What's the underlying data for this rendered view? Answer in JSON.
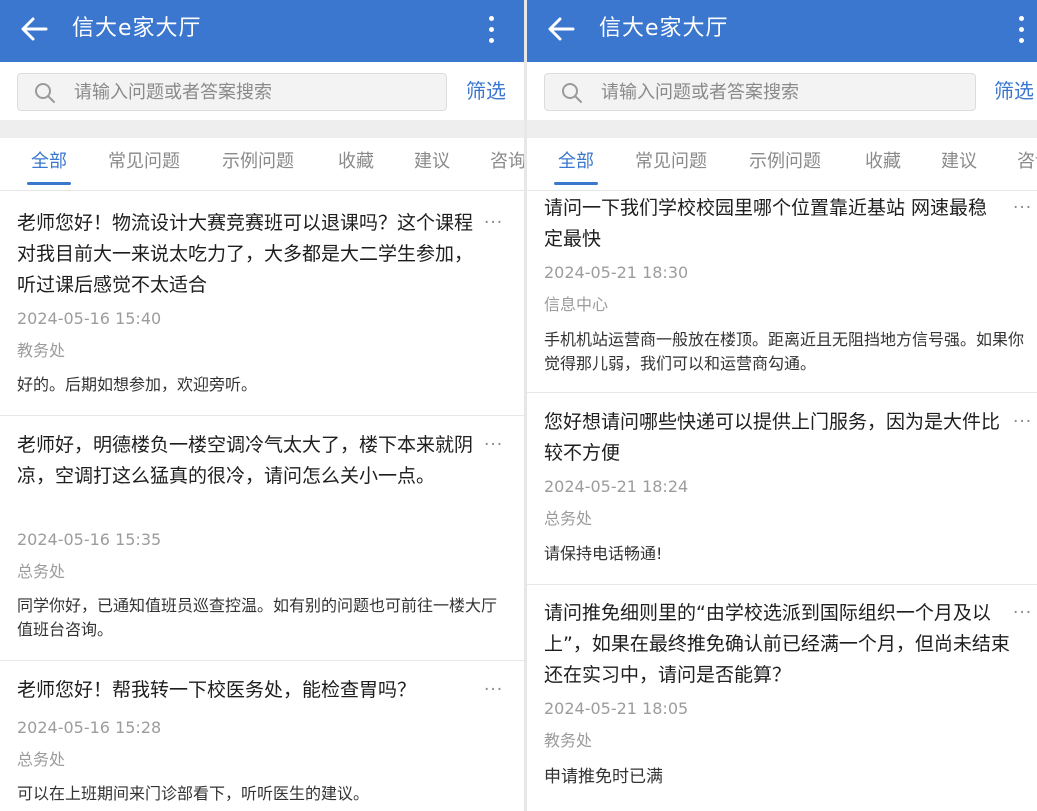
{
  "left": {
    "app_title": "信大e家大厅",
    "search_placeholder": "请输入问题或者答案搜索",
    "filter_label": "筛选",
    "tabs": [
      "全部",
      "常见问题",
      "示例问题",
      "收藏",
      "建议",
      "咨询"
    ],
    "items": [
      {
        "question": "老师您好！物流设计大赛竞赛班可以退课吗？这个课程对我目前大一来说太吃力了，大多都是大二学生参加，听过课后感觉不太适合",
        "time": "2024-05-16 15:40",
        "department": "教务处",
        "answer": "好的。后期如想参加，欢迎旁听。"
      },
      {
        "question": "老师好，明德楼负一楼空调冷气太大了，楼下本来就阴凉，空调打这么猛真的很冷，请问怎么关小一点。",
        "time": "2024-05-16 15:35",
        "department": "总务处",
        "answer": "同学你好，已通知值班员巡查控温。如有别的问题也可前往一楼大厅值班台咨询。"
      },
      {
        "question": "老师您好！帮我转一下校医务处，能检查胃吗？",
        "time": "2024-05-16 15:28",
        "department": "总务处",
        "answer": "可以在上班期间来门诊部看下，听听医生的建议。"
      }
    ]
  },
  "right": {
    "app_title": "信大e家大厅",
    "search_placeholder": "请输入问题或者答案搜索",
    "filter_label": "筛选",
    "tabs": [
      "全部",
      "常见问题",
      "示例问题",
      "收藏",
      "建议",
      "咨询"
    ],
    "items": [
      {
        "question": "请问一下我们学校校园里哪个位置靠近基站 网速最稳定最快",
        "time": "2024-05-21 18:30",
        "department": "信息中心",
        "answer": "手机机站运营商一般放在楼顶。距离近且无阻挡地方信号强。如果你觉得那儿弱，我们可以和运营商勾通。"
      },
      {
        "question": "您好想请问哪些快递可以提供上门服务，因为是大件比较不方便",
        "time": "2024-05-21 18:24",
        "department": "总务处",
        "answer": "请保持电话畅通!"
      },
      {
        "question": "请问推免细则里的“由学校选派到国际组织一个月及以上”，如果在最终推免确认前已经满一个月，但尚未结束还在实习中，请问是否能算？",
        "time": "2024-05-21 18:05",
        "department": "教务处",
        "answer": "申请推免时已满"
      }
    ]
  },
  "more_label": "···",
  "colors": {
    "brand": "#3b77cf",
    "text": "#1e1e1e",
    "muted": "#9c9c9c"
  },
  "icons": [
    "back-arrow-icon",
    "more-vert-icon",
    "search-icon",
    "ellipsis-icon"
  ]
}
